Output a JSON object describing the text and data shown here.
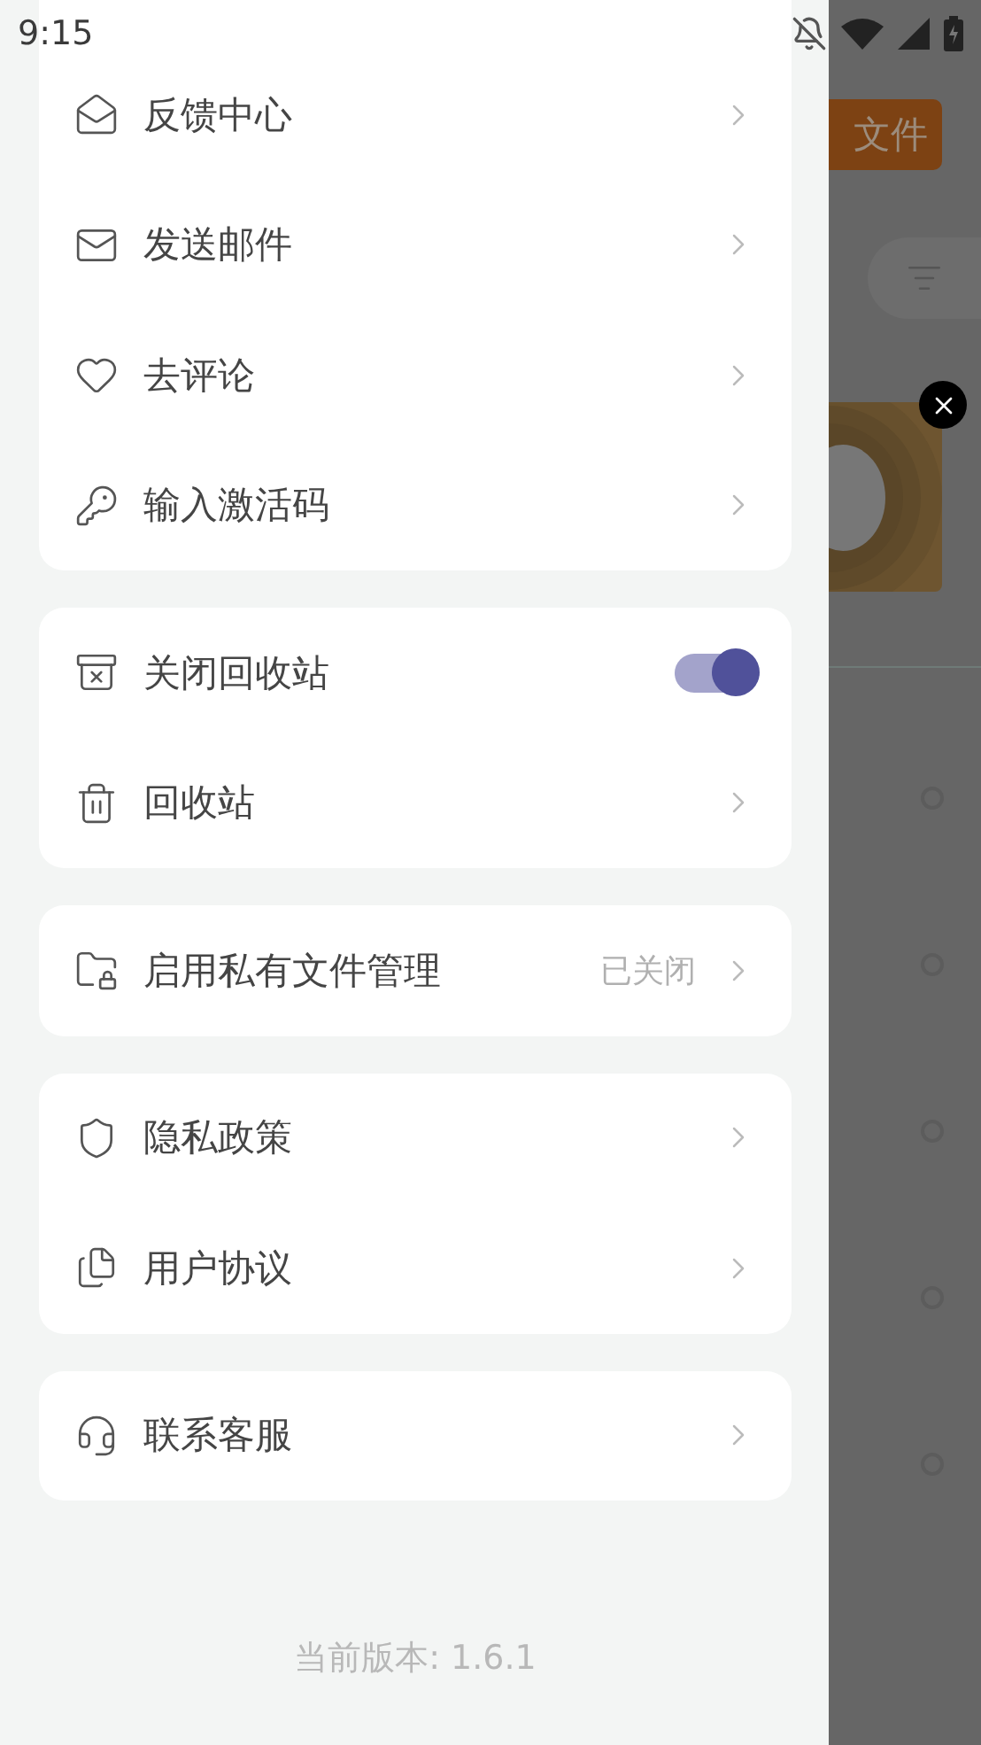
{
  "status_bar": {
    "time": "9:15"
  },
  "menu_groups": [
    {
      "items": [
        {
          "kind": "link",
          "label": "反馈中心"
        },
        {
          "kind": "link",
          "label": "发送邮件"
        },
        {
          "kind": "link",
          "label": "去评论"
        },
        {
          "kind": "link",
          "label": "输入激活码"
        }
      ]
    },
    {
      "items": [
        {
          "kind": "switch",
          "label": "关闭回收站",
          "on": true
        },
        {
          "kind": "link",
          "label": "回收站"
        }
      ]
    },
    {
      "items": [
        {
          "kind": "link",
          "label": "启用私有文件管理",
          "value": "已关闭"
        }
      ]
    },
    {
      "items": [
        {
          "kind": "link",
          "label": "隐私政策"
        },
        {
          "kind": "link",
          "label": "用户协议"
        }
      ]
    },
    {
      "items": [
        {
          "kind": "link",
          "label": "联系客服"
        }
      ]
    }
  ],
  "version": "当前版本: 1.6.1",
  "background": {
    "button": "文件",
    "rows": [
      {
        "selected": false
      },
      {
        "selected": false
      },
      {
        "selected": false
      },
      {
        "selected": false
      },
      {
        "selected": false
      }
    ]
  }
}
